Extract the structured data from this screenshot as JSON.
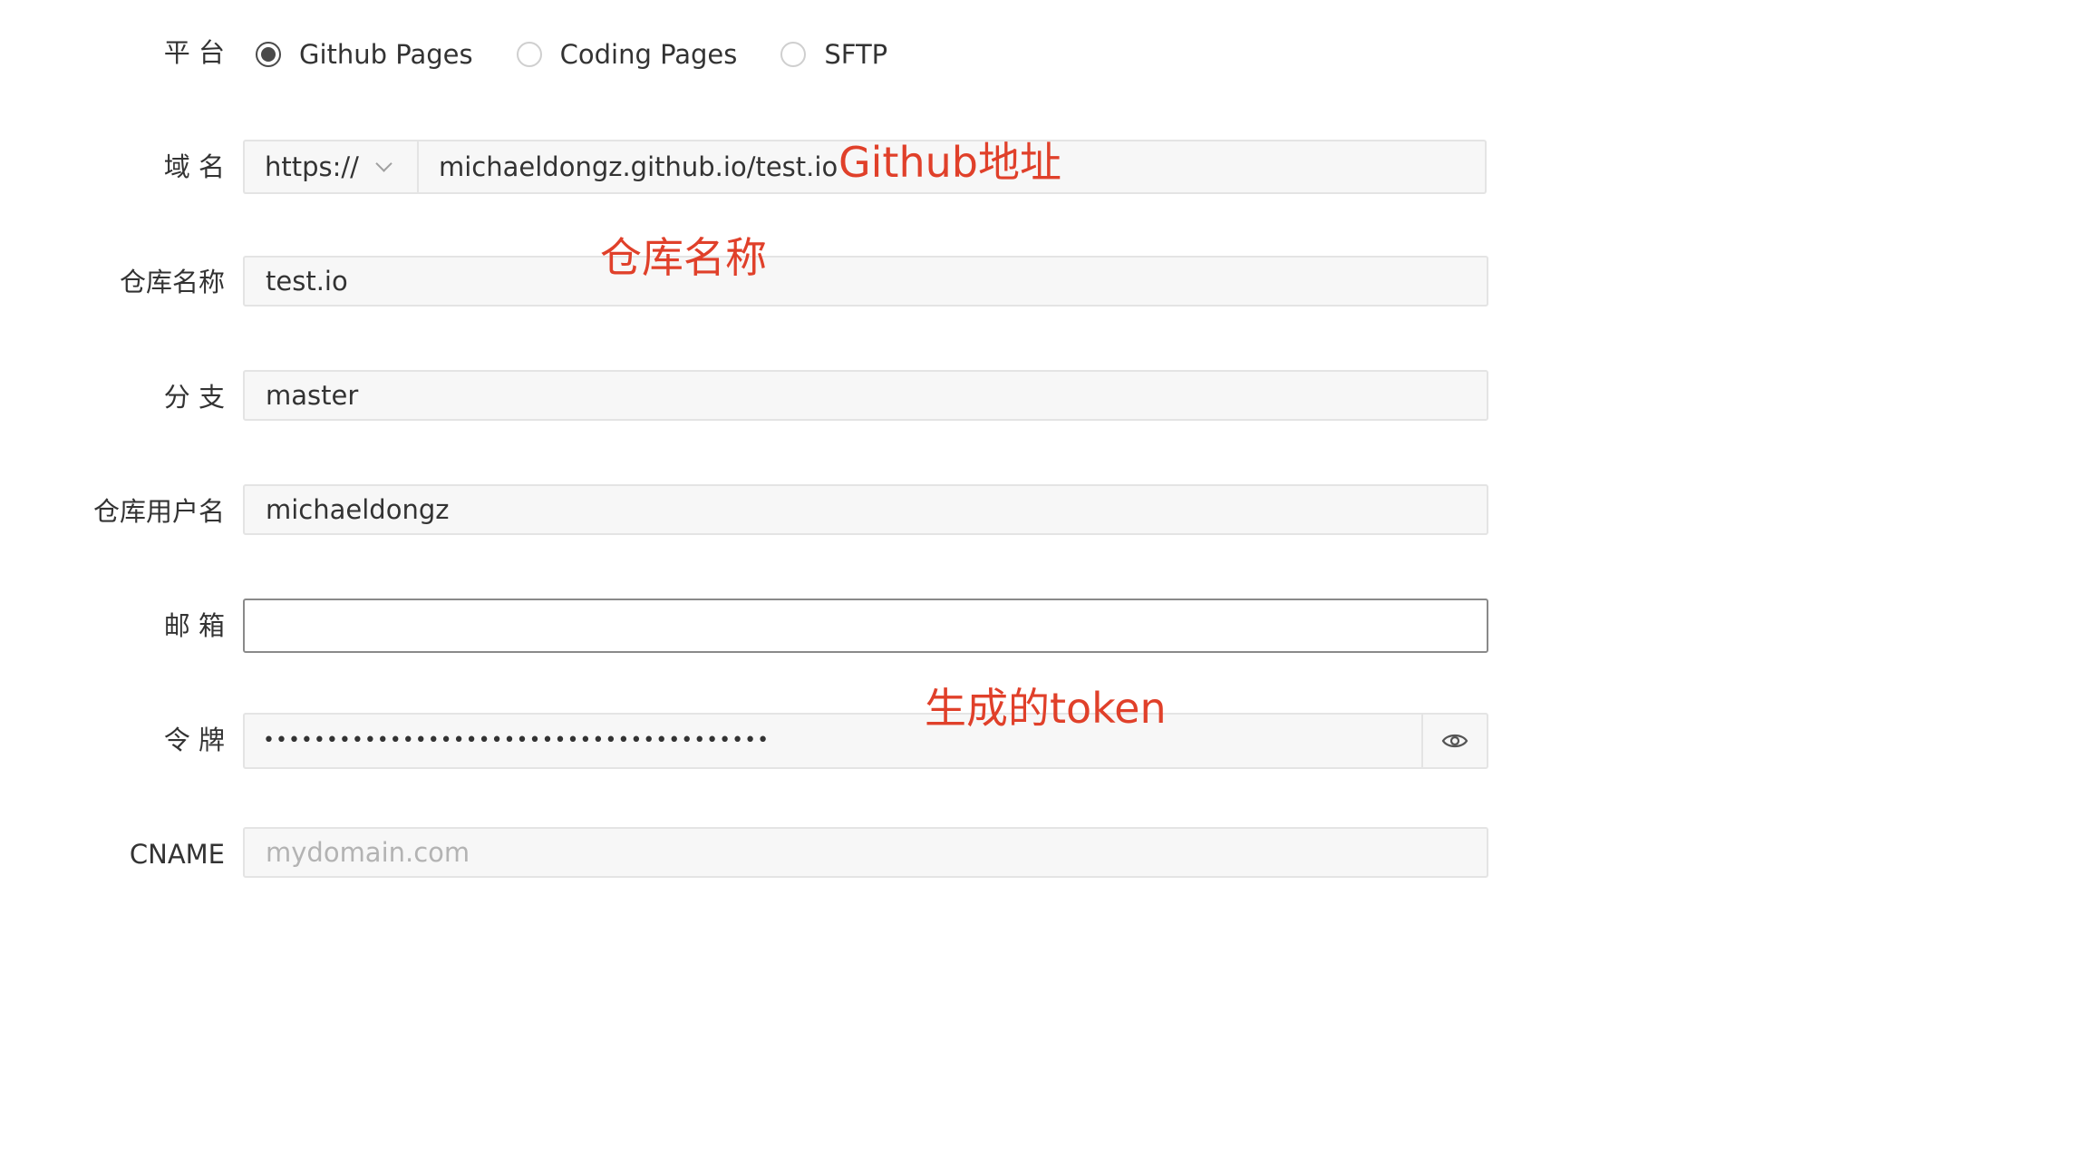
{
  "platform": {
    "label": "平 台",
    "options": [
      {
        "label": "Github Pages",
        "checked": true
      },
      {
        "label": "Coding Pages",
        "checked": false
      },
      {
        "label": "SFTP",
        "checked": false
      }
    ]
  },
  "domain": {
    "label": "域 名",
    "protocol": "https://",
    "value": "michaeldongz.github.io/test.io"
  },
  "repo_name": {
    "label": "仓库名称",
    "value": "test.io"
  },
  "branch": {
    "label": "分 支",
    "value": "master"
  },
  "repo_user": {
    "label": "仓库用户名",
    "value": "michaeldongz"
  },
  "email": {
    "label": "邮 箱",
    "value": ""
  },
  "token": {
    "label": "令 牌",
    "masked_value": "••••••••••••••••••••••••••••••••••••••••"
  },
  "cname": {
    "label": "CNAME",
    "placeholder": "mydomain.com"
  },
  "annotations": {
    "github_address": "Github地址",
    "repo_name": "仓库名称",
    "generated_token": "生成的token"
  },
  "colors": {
    "annotation": "#e0402a",
    "field_bg": "#f7f7f7",
    "field_border": "#e4e4e4"
  }
}
